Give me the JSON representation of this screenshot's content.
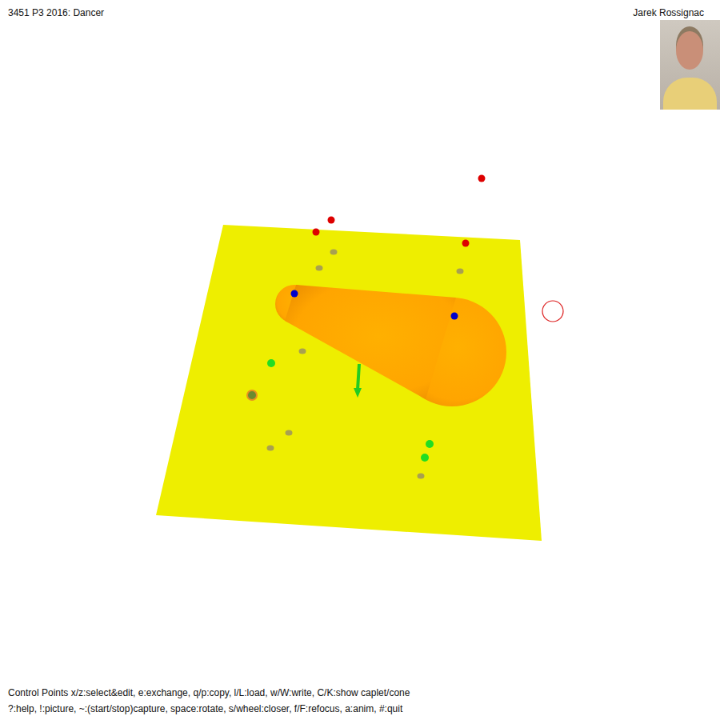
{
  "window": {
    "title": "3451 P3 2016: Dancer"
  },
  "author": {
    "name": "Jarek Rossignac"
  },
  "help": [
    "Control Points x/z:select&edit, e:exchange, q/p:copy, l/L:load, w/W:write, C/K:show caplet/cone",
    "?:help, !:picture, ~:(start/stop)capture, space:rotate, s/wheel:closer, f/F:refocus, a:anim, #:quit"
  ]
}
